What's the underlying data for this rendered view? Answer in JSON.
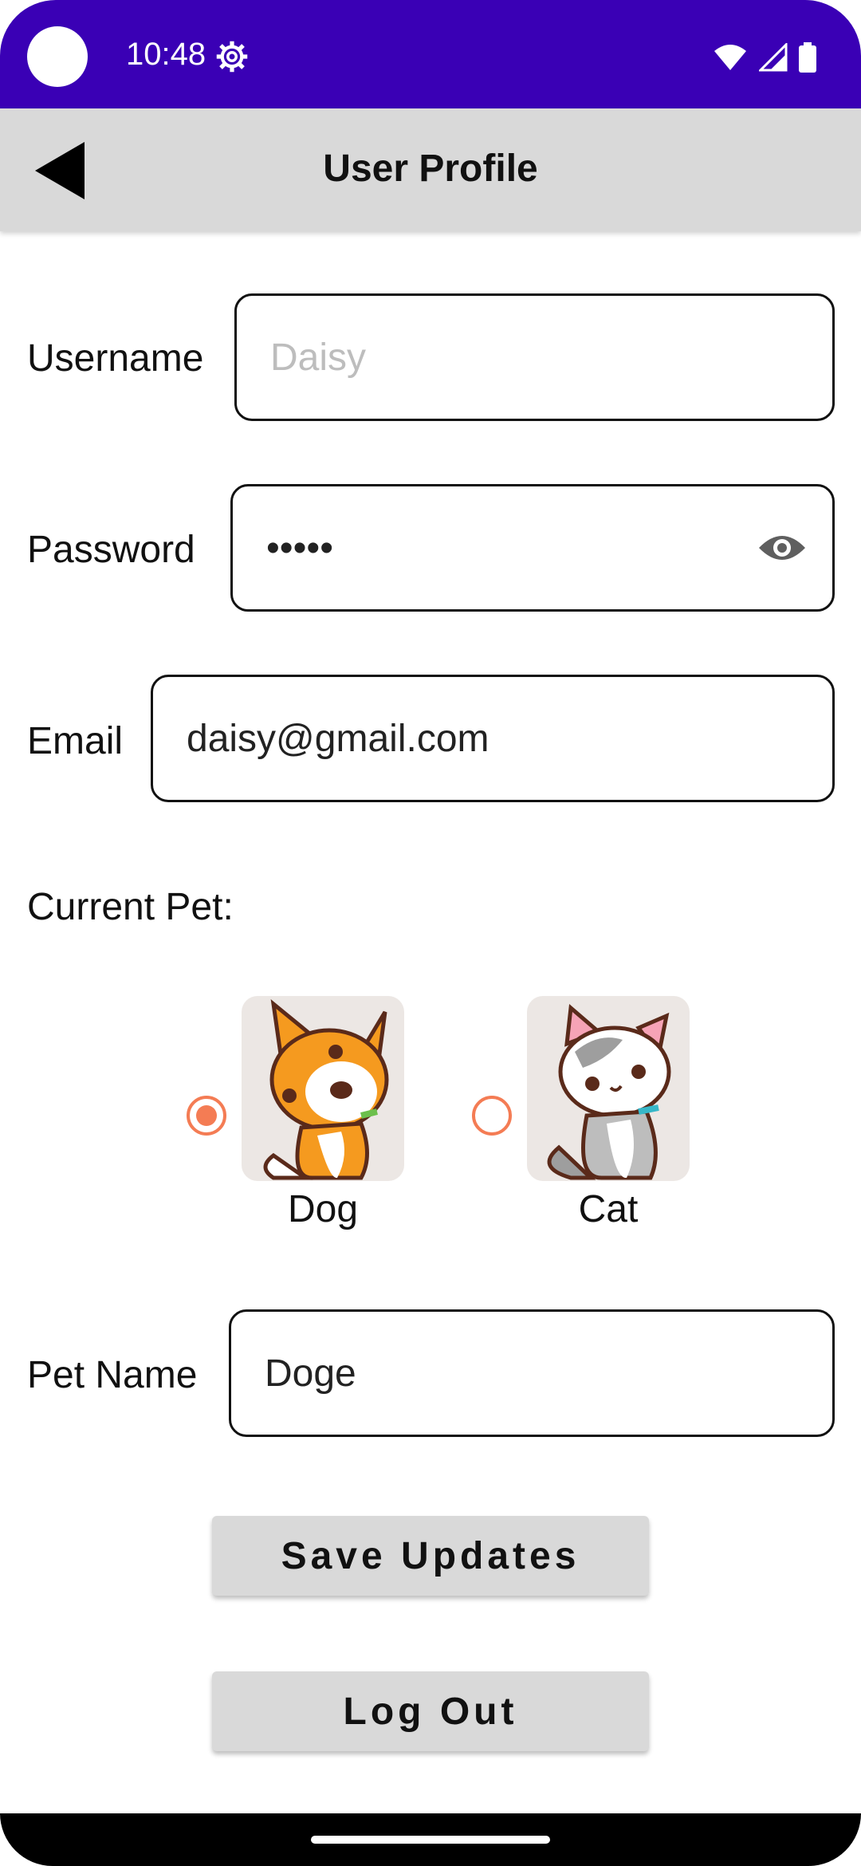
{
  "status_bar": {
    "time": "10:48"
  },
  "app_bar": {
    "title": "User Profile"
  },
  "form": {
    "username": {
      "label": "Username",
      "placeholder": "Daisy"
    },
    "password": {
      "label": "Password",
      "value": "•••••"
    },
    "email": {
      "label": "Email",
      "value": "daisy@gmail.com"
    },
    "current_pet_label": "Current Pet:",
    "pets": [
      {
        "name": "Dog",
        "selected": true
      },
      {
        "name": "Cat",
        "selected": false
      }
    ],
    "pet_name": {
      "label": "Pet Name",
      "value": "Doge"
    }
  },
  "buttons": {
    "save": "Save Updates",
    "logout": "Log Out"
  },
  "colors": {
    "status_bar": "#3a00b5",
    "accent": "#f47c54",
    "app_bar": "#d9d9d9"
  }
}
